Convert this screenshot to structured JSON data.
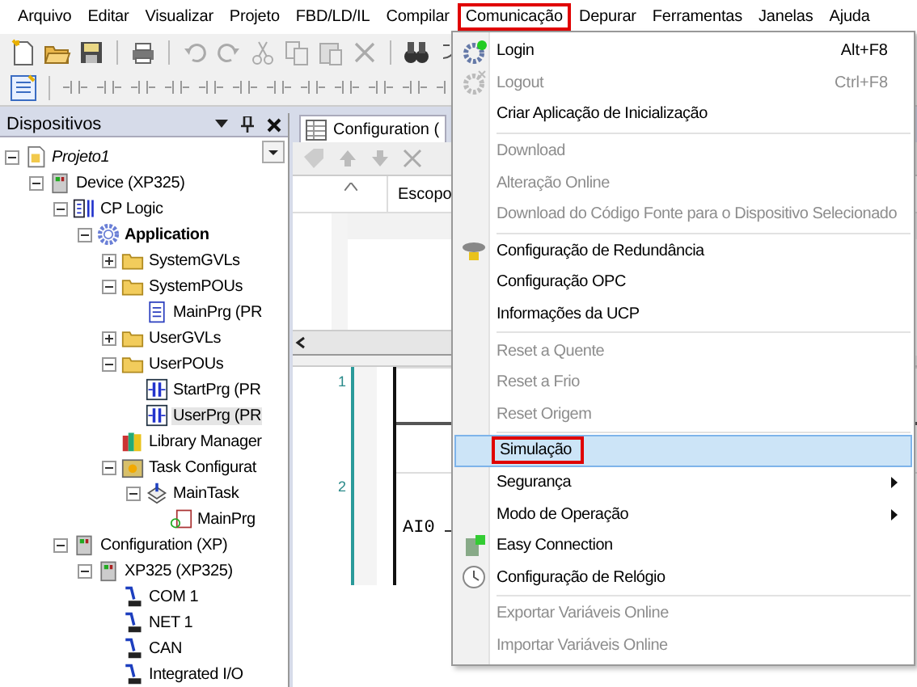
{
  "menubar": {
    "items": [
      {
        "label": "Arquivo",
        "selected": false
      },
      {
        "label": "Editar",
        "selected": false
      },
      {
        "label": "Visualizar",
        "selected": false
      },
      {
        "label": "Projeto",
        "selected": false
      },
      {
        "label": "FBD/LD/IL",
        "selected": false
      },
      {
        "label": "Compilar",
        "selected": false
      },
      {
        "label": "Comunicação",
        "selected": true
      },
      {
        "label": "Depurar",
        "selected": false
      },
      {
        "label": "Ferramentas",
        "selected": false
      },
      {
        "label": "Janelas",
        "selected": false
      },
      {
        "label": "Ajuda",
        "selected": false
      }
    ]
  },
  "device_panel": {
    "title": "Dispositivos",
    "nodes": [
      {
        "label": "Projeto1",
        "kind": "project",
        "expanded": true,
        "selected": false,
        "active": false,
        "children": [
          {
            "label": "Device (XP325)",
            "kind": "device",
            "expanded": true,
            "selected": false,
            "active": false,
            "children": [
              {
                "label": "CP Logic",
                "kind": "plc",
                "expanded": true,
                "selected": false,
                "active": false,
                "children": [
                  {
                    "label": "Application",
                    "kind": "application",
                    "expanded": true,
                    "selected": false,
                    "active": true,
                    "children": [
                      {
                        "label": "SystemGVLs",
                        "kind": "folder",
                        "expanded": false,
                        "selected": false,
                        "active": false
                      },
                      {
                        "label": "SystemPOUs",
                        "kind": "folder",
                        "expanded": true,
                        "selected": false,
                        "active": false,
                        "children": [
                          {
                            "label": "MainPrg (PR",
                            "kind": "pou",
                            "selected": false,
                            "active": false
                          }
                        ]
                      },
                      {
                        "label": "UserGVLs",
                        "kind": "folder",
                        "expanded": false,
                        "selected": false,
                        "active": false
                      },
                      {
                        "label": "UserPOUs",
                        "kind": "folder",
                        "expanded": true,
                        "selected": false,
                        "active": false,
                        "children": [
                          {
                            "label": "StartPrg (PR",
                            "kind": "ladder",
                            "selected": false,
                            "active": false
                          },
                          {
                            "label": "UserPrg (PR",
                            "kind": "ladder",
                            "selected": true,
                            "active": false
                          }
                        ]
                      },
                      {
                        "label": "Library Manager",
                        "kind": "library",
                        "selected": false,
                        "active": false
                      },
                      {
                        "label": "Task Configurat",
                        "kind": "task-config",
                        "expanded": true,
                        "selected": false,
                        "active": false,
                        "children": [
                          {
                            "label": "MainTask",
                            "kind": "task",
                            "expanded": true,
                            "selected": false,
                            "active": false,
                            "children": [
                              {
                                "label": "MainPrg",
                                "kind": "task-call",
                                "selected": false,
                                "active": false
                              }
                            ]
                          }
                        ]
                      }
                    ]
                  }
                ]
              },
              {
                "label": "Configuration (XP)",
                "kind": "device",
                "expanded": true,
                "selected": false,
                "active": false,
                "children": [
                  {
                    "label": "XP325 (XP325)",
                    "kind": "device",
                    "expanded": true,
                    "selected": false,
                    "active": false,
                    "children": [
                      {
                        "label": "COM 1",
                        "kind": "port",
                        "selected": false,
                        "active": false
                      },
                      {
                        "label": "NET 1",
                        "kind": "port",
                        "selected": false,
                        "active": false
                      },
                      {
                        "label": "CAN",
                        "kind": "port",
                        "selected": false,
                        "active": false
                      },
                      {
                        "label": "Integrated I/O",
                        "kind": "port",
                        "selected": false,
                        "active": false
                      }
                    ]
                  }
                ]
              }
            ]
          }
        ]
      }
    ]
  },
  "editor": {
    "tab": "Configuration (",
    "column_header": "Escopo",
    "rungs": [
      {
        "number": "1"
      },
      {
        "number": "2",
        "input": "AI0"
      }
    ]
  },
  "menu": {
    "items": [
      {
        "kind": "item",
        "label": "Login",
        "shortcut": "Alt+F8",
        "disabled": false,
        "selected": false
      },
      {
        "kind": "item",
        "label": "Logout",
        "shortcut": "Ctrl+F8",
        "disabled": true,
        "selected": false
      },
      {
        "kind": "item",
        "label": "Criar Aplicação de Inicialização",
        "disabled": false,
        "selected": false
      },
      {
        "kind": "separator"
      },
      {
        "kind": "item",
        "label": "Download",
        "disabled": true,
        "selected": false
      },
      {
        "kind": "item",
        "label": "Alteração Online",
        "disabled": true,
        "selected": false
      },
      {
        "kind": "item",
        "label": "Download do Código Fonte para o Dispositivo Selecionado",
        "disabled": true,
        "selected": false
      },
      {
        "kind": "separator"
      },
      {
        "kind": "item",
        "label": "Configuração de Redundância",
        "disabled": false,
        "selected": false
      },
      {
        "kind": "item",
        "label": "Configuração OPC",
        "disabled": false,
        "selected": false
      },
      {
        "kind": "item",
        "label": "Informações da UCP",
        "disabled": false,
        "selected": false
      },
      {
        "kind": "separator"
      },
      {
        "kind": "item",
        "label": "Reset a Quente",
        "disabled": true,
        "selected": false
      },
      {
        "kind": "item",
        "label": "Reset a Frio",
        "disabled": true,
        "selected": false
      },
      {
        "kind": "item",
        "label": "Reset Origem",
        "disabled": true,
        "selected": false
      },
      {
        "kind": "separator"
      },
      {
        "kind": "item",
        "label": "Simulação",
        "disabled": false,
        "selected": true
      },
      {
        "kind": "submenu",
        "label": "Segurança",
        "disabled": false,
        "selected": false
      },
      {
        "kind": "submenu",
        "label": "Modo de Operação",
        "disabled": false,
        "selected": false
      },
      {
        "kind": "item",
        "label": "Easy Connection",
        "disabled": false,
        "selected": false
      },
      {
        "kind": "item",
        "label": "Configuração de Relógio",
        "disabled": false,
        "selected": false
      },
      {
        "kind": "separator"
      },
      {
        "kind": "item",
        "label": "Exportar Variáveis Online",
        "disabled": true,
        "selected": false
      },
      {
        "kind": "item",
        "label": "Importar Variáveis Online",
        "disabled": true,
        "selected": false
      }
    ]
  }
}
